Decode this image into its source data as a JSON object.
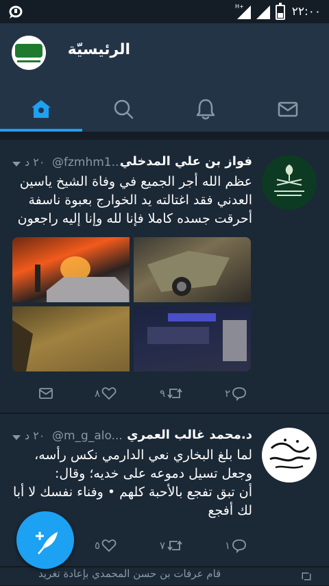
{
  "status_bar": {
    "time": "٢٢:٠٠",
    "network": "H+"
  },
  "header": {
    "title": "الرئيسيّة"
  },
  "tabs": [
    {
      "name": "home",
      "icon": "home-icon",
      "active": true
    },
    {
      "name": "search",
      "icon": "search-icon",
      "active": false
    },
    {
      "name": "notifications",
      "icon": "bell-icon",
      "active": false
    },
    {
      "name": "messages",
      "icon": "mail-icon",
      "active": false
    }
  ],
  "tweets": [
    {
      "name": "فواز بن علي المدخلي",
      "handle": "@fzmhm1...",
      "time": "٢٠ د",
      "body_lines": [
        "عظم الله أجر الجميع في وفاة الشيخ ياسين",
        "العدني فقد اغتالته يد الخوارج بعبوة ناسفة",
        "أحرقت جسده كاملا فإنا لله وإنا إليه راجعون"
      ],
      "counts": {
        "reply": "٢",
        "retweet": "٩",
        "like": "٨"
      }
    },
    {
      "name": "د.محمد غالب العمري",
      "handle": "@m_g_alo...",
      "time": "٢٠ د",
      "body_lines": [
        "لما بلغ البخاري نعي الدارمي نكس رأسه،",
        "وجعل تسيل دموعه على خديه؛ وقال:",
        "أن تبق تفجع بالأحبة كلهم • وفناء نفسك لا أبا",
        "لك أفجع"
      ],
      "counts": {
        "reply": "١",
        "retweet": "٧",
        "like": "٥"
      }
    }
  ],
  "partial_tweet": {
    "text": "قام عرفات بن حسن المحمدي بإعادة تغريد"
  },
  "colors": {
    "accent": "#1da1f2",
    "background": "#141d26",
    "card": "#1b2836",
    "header": "#243447",
    "muted": "#8899a6"
  }
}
